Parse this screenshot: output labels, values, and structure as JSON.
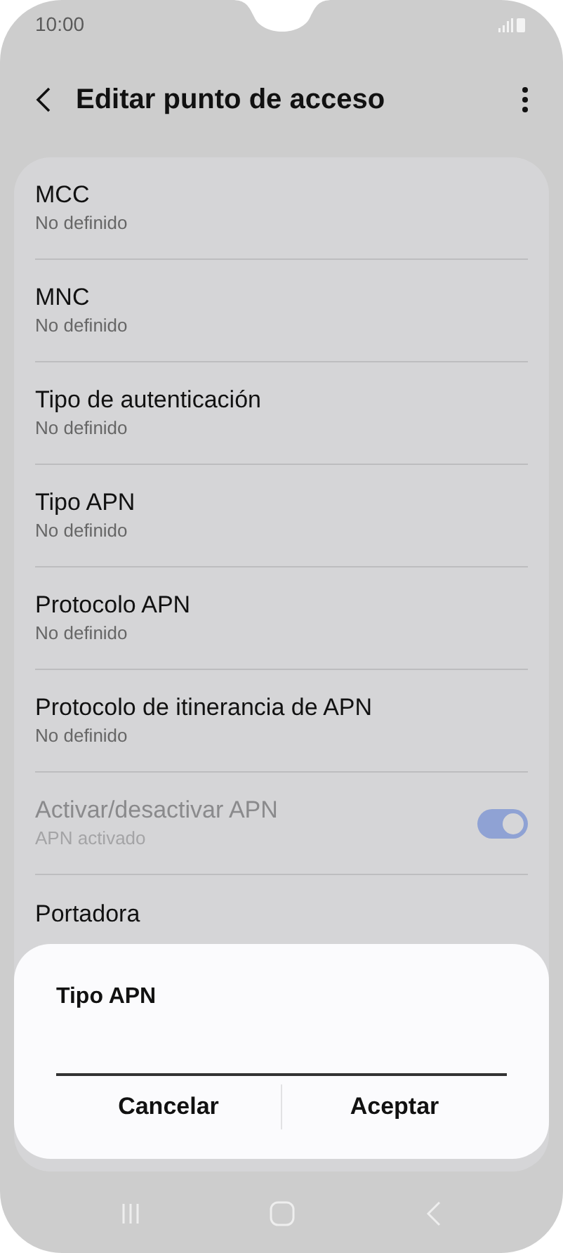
{
  "status_bar": {
    "time": "10:00"
  },
  "header": {
    "title": "Editar punto de acceso"
  },
  "settings": [
    {
      "kind": "text",
      "title": "MCC",
      "subtitle": "No definido",
      "disabled": false
    },
    {
      "kind": "text",
      "title": "MNC",
      "subtitle": "No definido",
      "disabled": false
    },
    {
      "kind": "text",
      "title": "Tipo de autenticación",
      "subtitle": "No definido",
      "disabled": false
    },
    {
      "kind": "text",
      "title": "Tipo APN",
      "subtitle": "No definido",
      "disabled": false
    },
    {
      "kind": "text",
      "title": "Protocolo APN",
      "subtitle": "No definido",
      "disabled": false
    },
    {
      "kind": "text",
      "title": "Protocolo de itinerancia de APN",
      "subtitle": "No definido",
      "disabled": false
    },
    {
      "kind": "toggle",
      "title": "Activar/desactivar APN",
      "subtitle": "APN activado",
      "disabled": true,
      "on": true
    },
    {
      "kind": "text",
      "title": "Portadora",
      "disabled": false
    }
  ],
  "dialog": {
    "title": "Tipo APN",
    "buttons": [
      "Cancelar",
      "Aceptar"
    ]
  }
}
